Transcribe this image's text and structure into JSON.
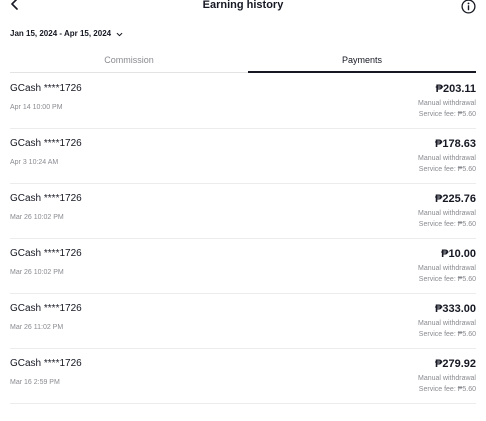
{
  "header": {
    "title": "Earning history",
    "back_icon": "chevron-left-icon",
    "info_icon": "info-circle-icon"
  },
  "filter": {
    "date_range": "Jan 15, 2024 - Apr 15, 2024",
    "dropdown_icon": "chevron-down-icon"
  },
  "tabs": [
    {
      "label": "Commission",
      "active": false
    },
    {
      "label": "Payments",
      "active": true
    }
  ],
  "payments": [
    {
      "account": "GCash ****1726",
      "datetime": "Apr 14 10:00 PM",
      "amount": "₱203.11",
      "type": "Manual withdrawal",
      "fee": "Service fee: ₱5.60"
    },
    {
      "account": "GCash ****1726",
      "datetime": "Apr 3 10:24 AM",
      "amount": "₱178.63",
      "type": "Manual withdrawal",
      "fee": "Service fee: ₱5.60"
    },
    {
      "account": "GCash ****1726",
      "datetime": "Mar 26 10:02 PM",
      "amount": "₱225.76",
      "type": "Manual withdrawal",
      "fee": "Service fee: ₱5.60"
    },
    {
      "account": "GCash ****1726",
      "datetime": "Mar 26 10:02 PM",
      "amount": "₱10.00",
      "type": "Manual withdrawal",
      "fee": "Service fee: ₱5.60"
    },
    {
      "account": "GCash ****1726",
      "datetime": "Mar 26 11:02 PM",
      "amount": "₱333.00",
      "type": "Manual withdrawal",
      "fee": "Service fee: ₱5.60"
    },
    {
      "account": "GCash ****1726",
      "datetime": "Mar 16 2:59 PM",
      "amount": "₱279.92",
      "type": "Manual withdrawal",
      "fee": "Service fee: ₱5.60"
    }
  ],
  "colors": {
    "text_primary": "#161823",
    "text_secondary": "#8a8b91",
    "divider": "#ececed"
  }
}
